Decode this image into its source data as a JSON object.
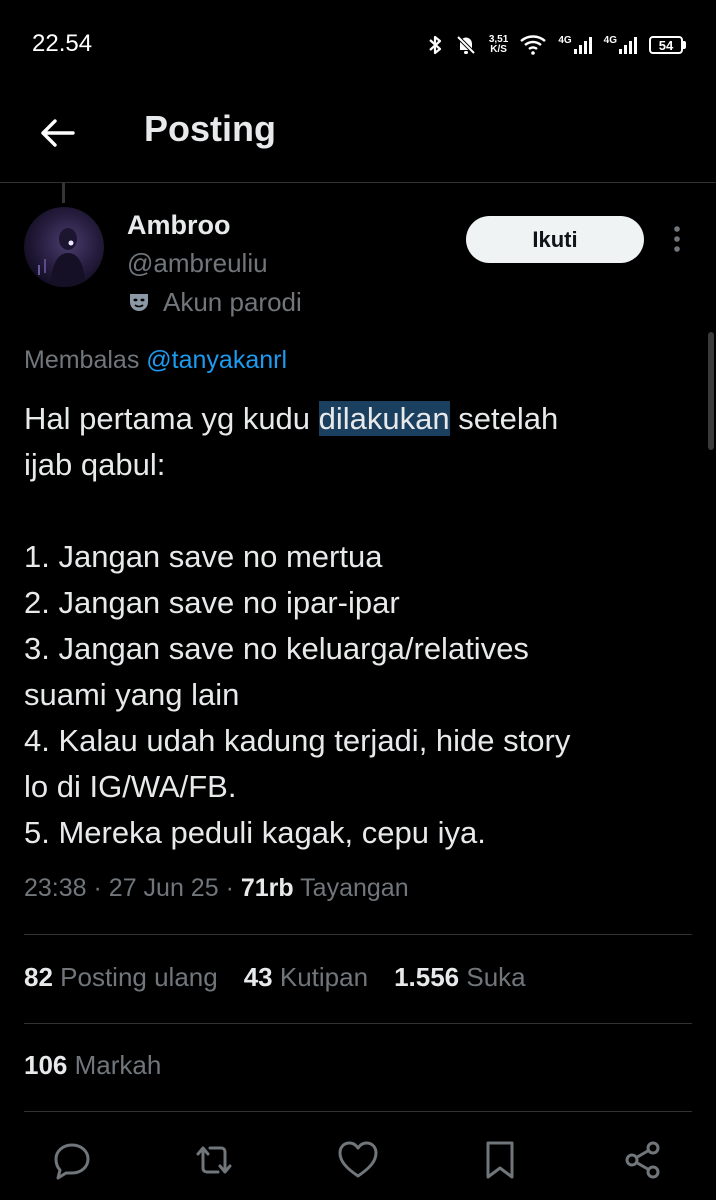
{
  "status_bar": {
    "time": "22.54",
    "speed_value": "3,51",
    "speed_unit": "K/S",
    "net1": "4G",
    "net2": "4G",
    "battery": "54"
  },
  "header": {
    "title": "Posting"
  },
  "tweet": {
    "display_name": "Ambroo",
    "handle": "@ambreuliu",
    "parody_label": "Akun parodi",
    "follow_label": "Ikuti",
    "reply_prefix": "Membalas",
    "reply_mention": "@tanyakanrl",
    "line1_before": "Hal pertama yg kudu ",
    "line1_highlight": "dilakukan",
    "line1_after": " setelah",
    "line2": "ijab qabul:",
    "line3": "1. Jangan save no mertua",
    "line4": "2. Jangan save no ipar-ipar",
    "line5": "3. Jangan save no keluarga/relatives",
    "line6": "suami yang lain",
    "line7": "4. Kalau udah kadung terjadi, hide story",
    "line8": "lo di IG/WA/FB.",
    "line9": "5. Mereka peduli kagak, cepu iya.",
    "time": "23:38",
    "date": "27 Jun 25",
    "views_count": "71rb",
    "views_label": "Tayangan",
    "separator": "·"
  },
  "stats": {
    "reposts_count": "82",
    "reposts_label": "Posting ulang",
    "quotes_count": "43",
    "quotes_label": "Kutipan",
    "likes_count": "1.556",
    "likes_label": "Suka",
    "bookmarks_count": "106",
    "bookmarks_label": "Markah"
  },
  "colors": {
    "background": "#000000",
    "text_primary": "#e7e9ea",
    "text_secondary": "#71767b",
    "accent": "#1d9bf0",
    "divider": "#2f3336"
  }
}
